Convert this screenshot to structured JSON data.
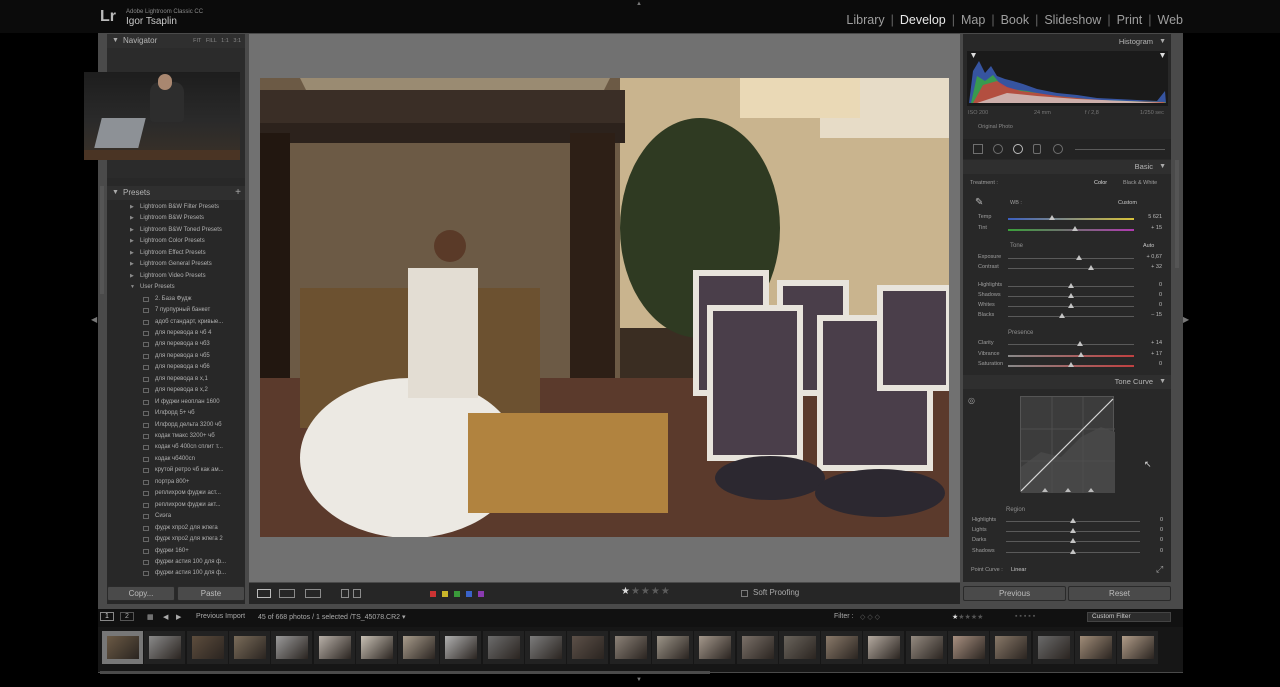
{
  "app": {
    "logo": "Lr",
    "product": "Adobe Lightroom Classic CC",
    "user": "Igor Tsaplin"
  },
  "modules": [
    {
      "label": "Library",
      "active": false
    },
    {
      "label": "Develop",
      "active": true
    },
    {
      "label": "Map",
      "active": false
    },
    {
      "label": "Book",
      "active": false
    },
    {
      "label": "Slideshow",
      "active": false
    },
    {
      "label": "Print",
      "active": false
    },
    {
      "label": "Web",
      "active": false
    }
  ],
  "navigator": {
    "title": "Navigator",
    "modes": "FIT FILL 1:1 3:1"
  },
  "presets": {
    "title": "Presets",
    "add": "+",
    "folders": [
      "Lightroom B&W Filter Presets",
      "Lightroom B&W Presets",
      "Lightroom B&W Toned Presets",
      "Lightroom Color Presets",
      "Lightroom Effect Presets",
      "Lightroom General Presets",
      "Lightroom Video Presets",
      "User Presets"
    ],
    "items": [
      "2. База Фудж",
      "7 пурпурный банкет",
      "адоб стандарт, кривые...",
      "для перевода в чб 4",
      "для перевода в чб3",
      "для перевода в чб5",
      "для перевода в чб6",
      "для перевода в х,1",
      "для перевода в х,2",
      "И фуджи неоплан 1600",
      "Илфорд 5+ чб",
      "Илфорд дельта 3200 чб",
      "кодак тмакс 3200+ чб",
      "кодак чб 400cn сплит т...",
      "кодак чб400cn",
      "крутой ретро чб как ам...",
      "портра 800+",
      "реплихром фуджи аст...",
      "реплихром фуджи акт...",
      "Сиэга",
      "фудж хпро2 для жпега",
      "фудж хпро2 для жпега 2",
      "фуджи 160+",
      "фуджи астия 100 для ф...",
      "фуджи астия 100 для ф..."
    ]
  },
  "left_buttons": {
    "copy": "Copy...",
    "paste": "Paste"
  },
  "toolbar": {
    "soft_proofing": "Soft Proofing",
    "stars_on": "★",
    "stars_off": "★★★★"
  },
  "histogram": {
    "title": "Histogram",
    "iso": "ISO 200",
    "focal": "24 mm",
    "aperture": "f / 2,8",
    "shutter": "1/250 sec",
    "original_photo": "Original Photo"
  },
  "basic": {
    "title": "Basic",
    "treatment_label": "Treatment :",
    "color": "Color",
    "bw": "Black & White",
    "wb_label": "WB :",
    "wb_value": "Custom",
    "tone": "Tone",
    "auto": "Auto",
    "presence": "Presence",
    "sliders": [
      {
        "label": "Temp",
        "value": "5 621",
        "pos": 0.35
      },
      {
        "label": "Tint",
        "value": "+ 15",
        "pos": 0.53
      },
      {
        "label": "Exposure",
        "value": "+ 0,67",
        "pos": 0.56
      },
      {
        "label": "Contrast",
        "value": "+ 32",
        "pos": 0.66
      },
      {
        "label": "Highlights",
        "value": "0",
        "pos": 0.5
      },
      {
        "label": "Shadows",
        "value": "0",
        "pos": 0.5
      },
      {
        "label": "Whites",
        "value": "0",
        "pos": 0.5
      },
      {
        "label": "Blacks",
        "value": "– 15",
        "pos": 0.43
      },
      {
        "label": "Clarity",
        "value": "+ 14",
        "pos": 0.57
      },
      {
        "label": "Vibrance",
        "value": "+ 17",
        "pos": 0.58
      },
      {
        "label": "Saturation",
        "value": "0",
        "pos": 0.5
      }
    ]
  },
  "tone_curve": {
    "title": "Tone Curve",
    "region": "Region",
    "point_curve_label": "Point Curve :",
    "point_curve_value": "Linear",
    "sliders": [
      {
        "label": "Highlights",
        "value": "0",
        "pos": 0.5
      },
      {
        "label": "Lights",
        "value": "0",
        "pos": 0.5
      },
      {
        "label": "Darks",
        "value": "0",
        "pos": 0.5
      },
      {
        "label": "Shadows",
        "value": "0",
        "pos": 0.5
      }
    ]
  },
  "right_buttons": {
    "previous": "Previous",
    "reset": "Reset"
  },
  "filmstrip": {
    "page1": "1",
    "page2": "2",
    "source": "Previous Import",
    "info": "45 of 668 photos / 1 selected /TS_45078.CR2 ▾",
    "filter_label": "Filter :",
    "custom_filter": "Custom Filter"
  }
}
